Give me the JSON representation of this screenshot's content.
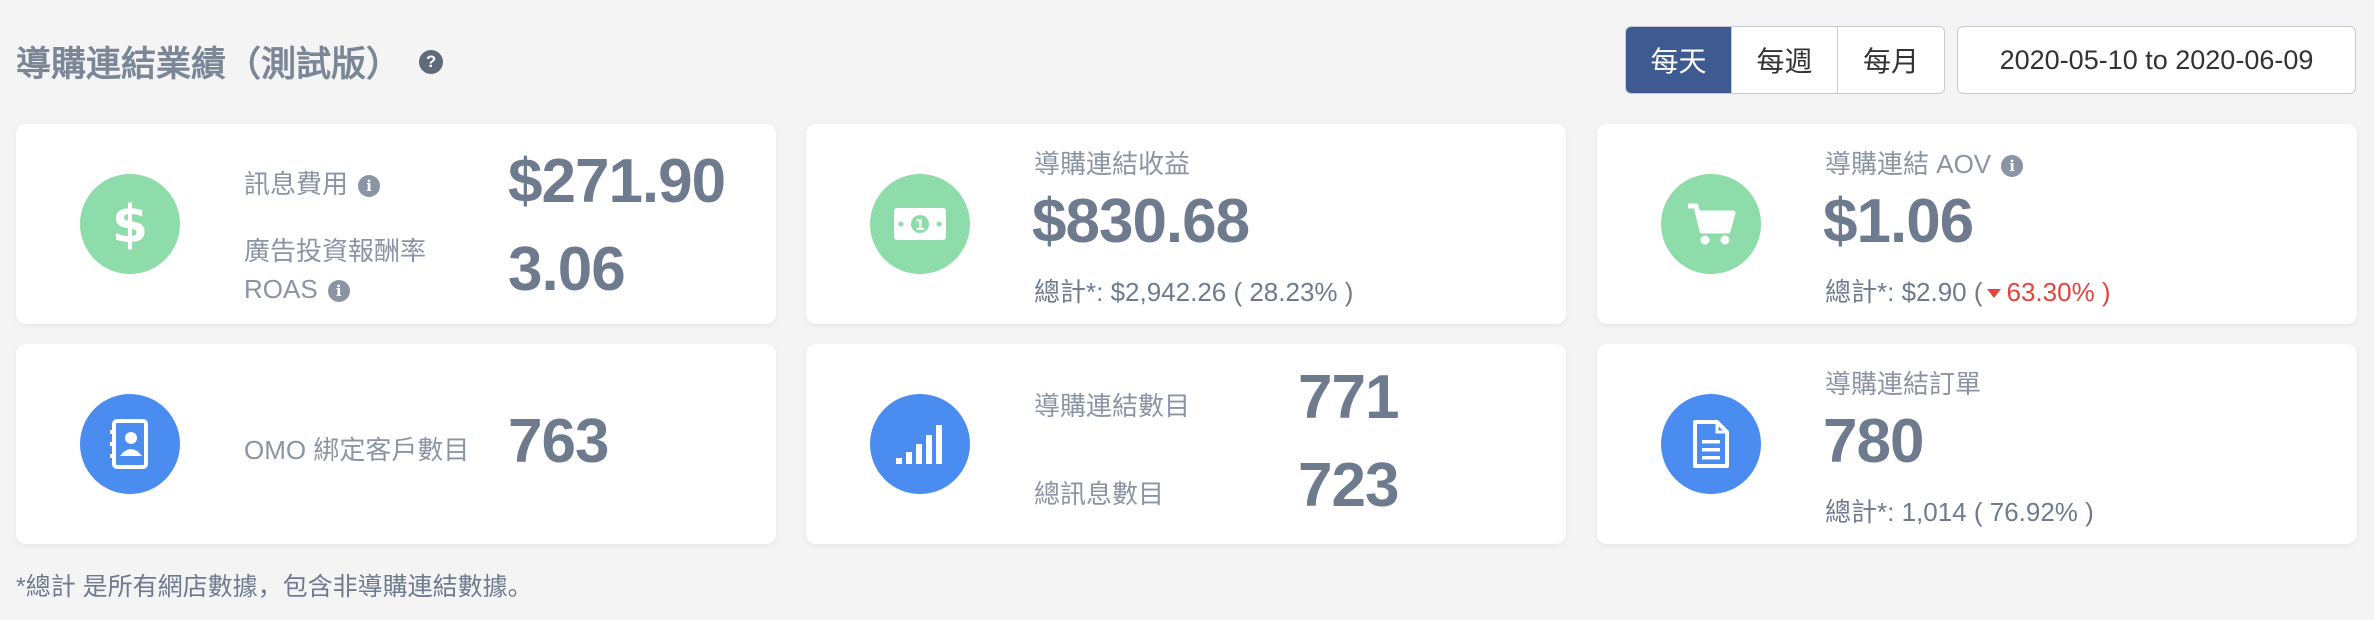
{
  "header": {
    "title": "導購連結業績（測試版）",
    "help_icon": "?"
  },
  "period_toggle": {
    "options": [
      "每天",
      "每週",
      "每月"
    ],
    "selected": "每天"
  },
  "date_range": "2020-05-10 to 2020-06-09",
  "cards": {
    "message_cost": {
      "icon": "dollar-icon",
      "label": "訊息費用",
      "value": "$271.90",
      "roas_label_line1": "廣告投資報酬率",
      "roas_label_line2": "ROAS",
      "roas_value": "3.06"
    },
    "link_revenue": {
      "icon": "money-bill-icon",
      "label": "導購連結收益",
      "value": "$830.68",
      "total_text": "總計*: $2,942.26 ( 28.23% )"
    },
    "link_aov": {
      "icon": "cart-icon",
      "label": "導購連結 AOV",
      "value": "$1.06",
      "total_prefix": "總計*: $2.90 (",
      "total_change": "63.30% )"
    },
    "omo_customers": {
      "icon": "contact-book-icon",
      "label": "OMO 綁定客戶數目",
      "value": "763"
    },
    "link_counts": {
      "icon": "signal-bars-icon",
      "link_label": "導購連結數目",
      "link_value": "771",
      "message_label": "總訊息數目",
      "message_value": "723"
    },
    "link_orders": {
      "icon": "document-icon",
      "label": "導購連結訂單",
      "value": "780",
      "total_text": "總計*: 1,014 ( 76.92% )"
    }
  },
  "footnote": "*總計 是所有網店數據，包含非導購連結數據。",
  "colors": {
    "accent": "#3f5a91",
    "green_circle": "#8ddcaa",
    "blue_circle": "#4b8cf0",
    "negative": "#e5443d"
  }
}
